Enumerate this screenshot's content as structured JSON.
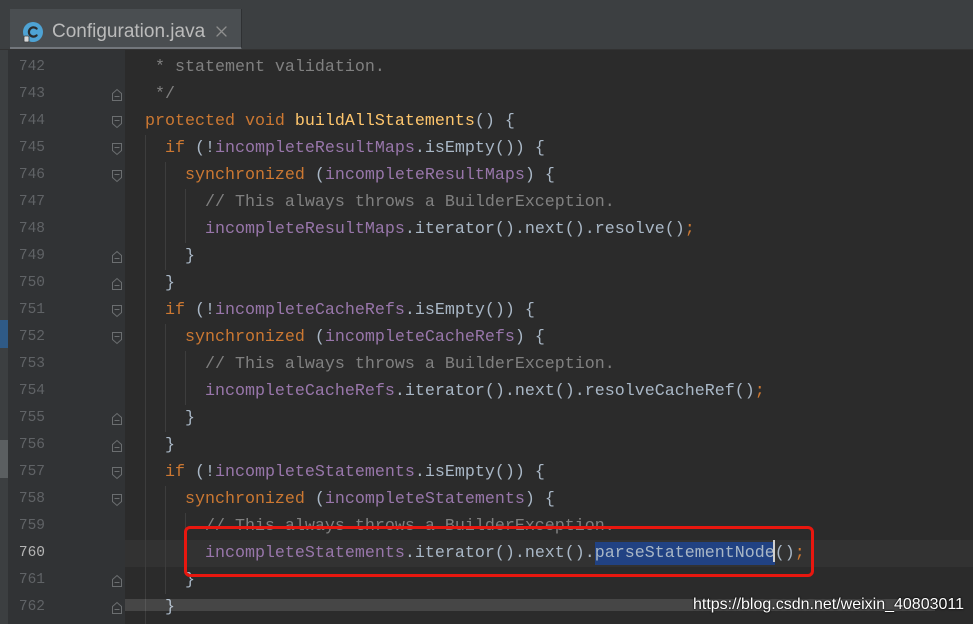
{
  "tabs": [
    {
      "label": "Configuration.java",
      "icon": "java-class-icon",
      "close_icon": "close-icon"
    }
  ],
  "colors": {
    "editor_bg": "#2b2b2b",
    "gutter_bg": "#313335",
    "current_line": "#323232",
    "selection": "#214283",
    "caret": "#d0d0d0",
    "annotation_box": "#e8170f"
  },
  "editor": {
    "lines": [
      {
        "number": "742",
        "tokens": [
          {
            "text": "   * statement validation.",
            "color": "#808080"
          }
        ]
      },
      {
        "number": "743",
        "fold": "fold-end-icon",
        "tokens": [
          {
            "text": "   */",
            "color": "#808080"
          }
        ]
      },
      {
        "number": "744",
        "fold": "fold-start-icon",
        "tokens": [
          {
            "text": "  protected void ",
            "color": "#cc7832"
          },
          {
            "text": "buildAllStatements",
            "color": "#ffc66d"
          },
          {
            "text": "() {",
            "color": "#a9b7c6"
          }
        ]
      },
      {
        "number": "745",
        "fold": "fold-start-icon",
        "tokens": [
          {
            "text": "    if ",
            "color": "#cc7832"
          },
          {
            "text": "(!",
            "color": "#a9b7c6"
          },
          {
            "text": "incompleteResultMaps",
            "color": "#9876aa"
          },
          {
            "text": ".isEmpty()) {",
            "color": "#a9b7c6"
          }
        ]
      },
      {
        "number": "746",
        "fold": "fold-start-icon",
        "tokens": [
          {
            "text": "      synchronized ",
            "color": "#cc7832"
          },
          {
            "text": "(",
            "color": "#a9b7c6"
          },
          {
            "text": "incompleteResultMaps",
            "color": "#9876aa"
          },
          {
            "text": ") {",
            "color": "#a9b7c6"
          }
        ]
      },
      {
        "number": "747",
        "tokens": [
          {
            "text": "        // This always throws a BuilderException.",
            "color": "#808080"
          }
        ]
      },
      {
        "number": "748",
        "tokens": [
          {
            "text": "        incompleteResultMaps",
            "color": "#9876aa"
          },
          {
            "text": ".iterator().next().resolve()",
            "color": "#a9b7c6"
          },
          {
            "text": ";",
            "color": "#cc7832"
          }
        ]
      },
      {
        "number": "749",
        "fold": "fold-end-icon",
        "tokens": [
          {
            "text": "      }",
            "color": "#a9b7c6"
          }
        ]
      },
      {
        "number": "750",
        "fold": "fold-end-icon",
        "tokens": [
          {
            "text": "    }",
            "color": "#a9b7c6"
          }
        ]
      },
      {
        "number": "751",
        "fold": "fold-start-icon",
        "tokens": [
          {
            "text": "    if ",
            "color": "#cc7832"
          },
          {
            "text": "(!",
            "color": "#a9b7c6"
          },
          {
            "text": "incompleteCacheRefs",
            "color": "#9876aa"
          },
          {
            "text": ".isEmpty()) {",
            "color": "#a9b7c6"
          }
        ]
      },
      {
        "number": "752",
        "fold": "fold-start-icon",
        "tokens": [
          {
            "text": "      synchronized ",
            "color": "#cc7832"
          },
          {
            "text": "(",
            "color": "#a9b7c6"
          },
          {
            "text": "incompleteCacheRefs",
            "color": "#9876aa"
          },
          {
            "text": ") {",
            "color": "#a9b7c6"
          }
        ]
      },
      {
        "number": "753",
        "tokens": [
          {
            "text": "        // This always throws a BuilderException.",
            "color": "#808080"
          }
        ]
      },
      {
        "number": "754",
        "tokens": [
          {
            "text": "        incompleteCacheRefs",
            "color": "#9876aa"
          },
          {
            "text": ".iterator().next().resolveCacheRef()",
            "color": "#a9b7c6"
          },
          {
            "text": ";",
            "color": "#cc7832"
          }
        ]
      },
      {
        "number": "755",
        "fold": "fold-end-icon",
        "tokens": [
          {
            "text": "      }",
            "color": "#a9b7c6"
          }
        ]
      },
      {
        "number": "756",
        "fold": "fold-end-icon",
        "tokens": [
          {
            "text": "    }",
            "color": "#a9b7c6"
          }
        ]
      },
      {
        "number": "757",
        "fold": "fold-start-icon",
        "tokens": [
          {
            "text": "    if ",
            "color": "#cc7832"
          },
          {
            "text": "(!",
            "color": "#a9b7c6"
          },
          {
            "text": "incompleteStatements",
            "color": "#9876aa"
          },
          {
            "text": ".isEmpty()) {",
            "color": "#a9b7c6"
          }
        ]
      },
      {
        "number": "758",
        "fold": "fold-start-icon",
        "tokens": [
          {
            "text": "      synchronized ",
            "color": "#cc7832"
          },
          {
            "text": "(",
            "color": "#a9b7c6"
          },
          {
            "text": "incompleteStatements",
            "color": "#9876aa"
          },
          {
            "text": ") {",
            "color": "#a9b7c6"
          }
        ]
      },
      {
        "number": "759",
        "tokens": [
          {
            "text": "        // This always throws a BuilderException.",
            "color": "#808080"
          }
        ]
      },
      {
        "number": "760",
        "current": true,
        "tokens": [
          {
            "text": "        incompleteStatements",
            "color": "#9876aa"
          },
          {
            "text": ".iterator().next().",
            "color": "#a9b7c6"
          },
          {
            "text": "parseStatementNode",
            "color": "#a9b7c6",
            "selected": true,
            "caret_after": true
          },
          {
            "text": "()",
            "color": "#a9b7c6"
          },
          {
            "text": ";",
            "color": "#cc7832"
          }
        ]
      },
      {
        "number": "761",
        "fold": "fold-end-icon",
        "tokens": [
          {
            "text": "      }",
            "color": "#a9b7c6"
          }
        ]
      },
      {
        "number": "762",
        "fold": "fold-end-icon",
        "tokens": [
          {
            "text": "    }",
            "color": "#a9b7c6"
          }
        ]
      }
    ]
  },
  "watermark": {
    "text": "https://blog.csdn.net/weixin_40803011"
  }
}
